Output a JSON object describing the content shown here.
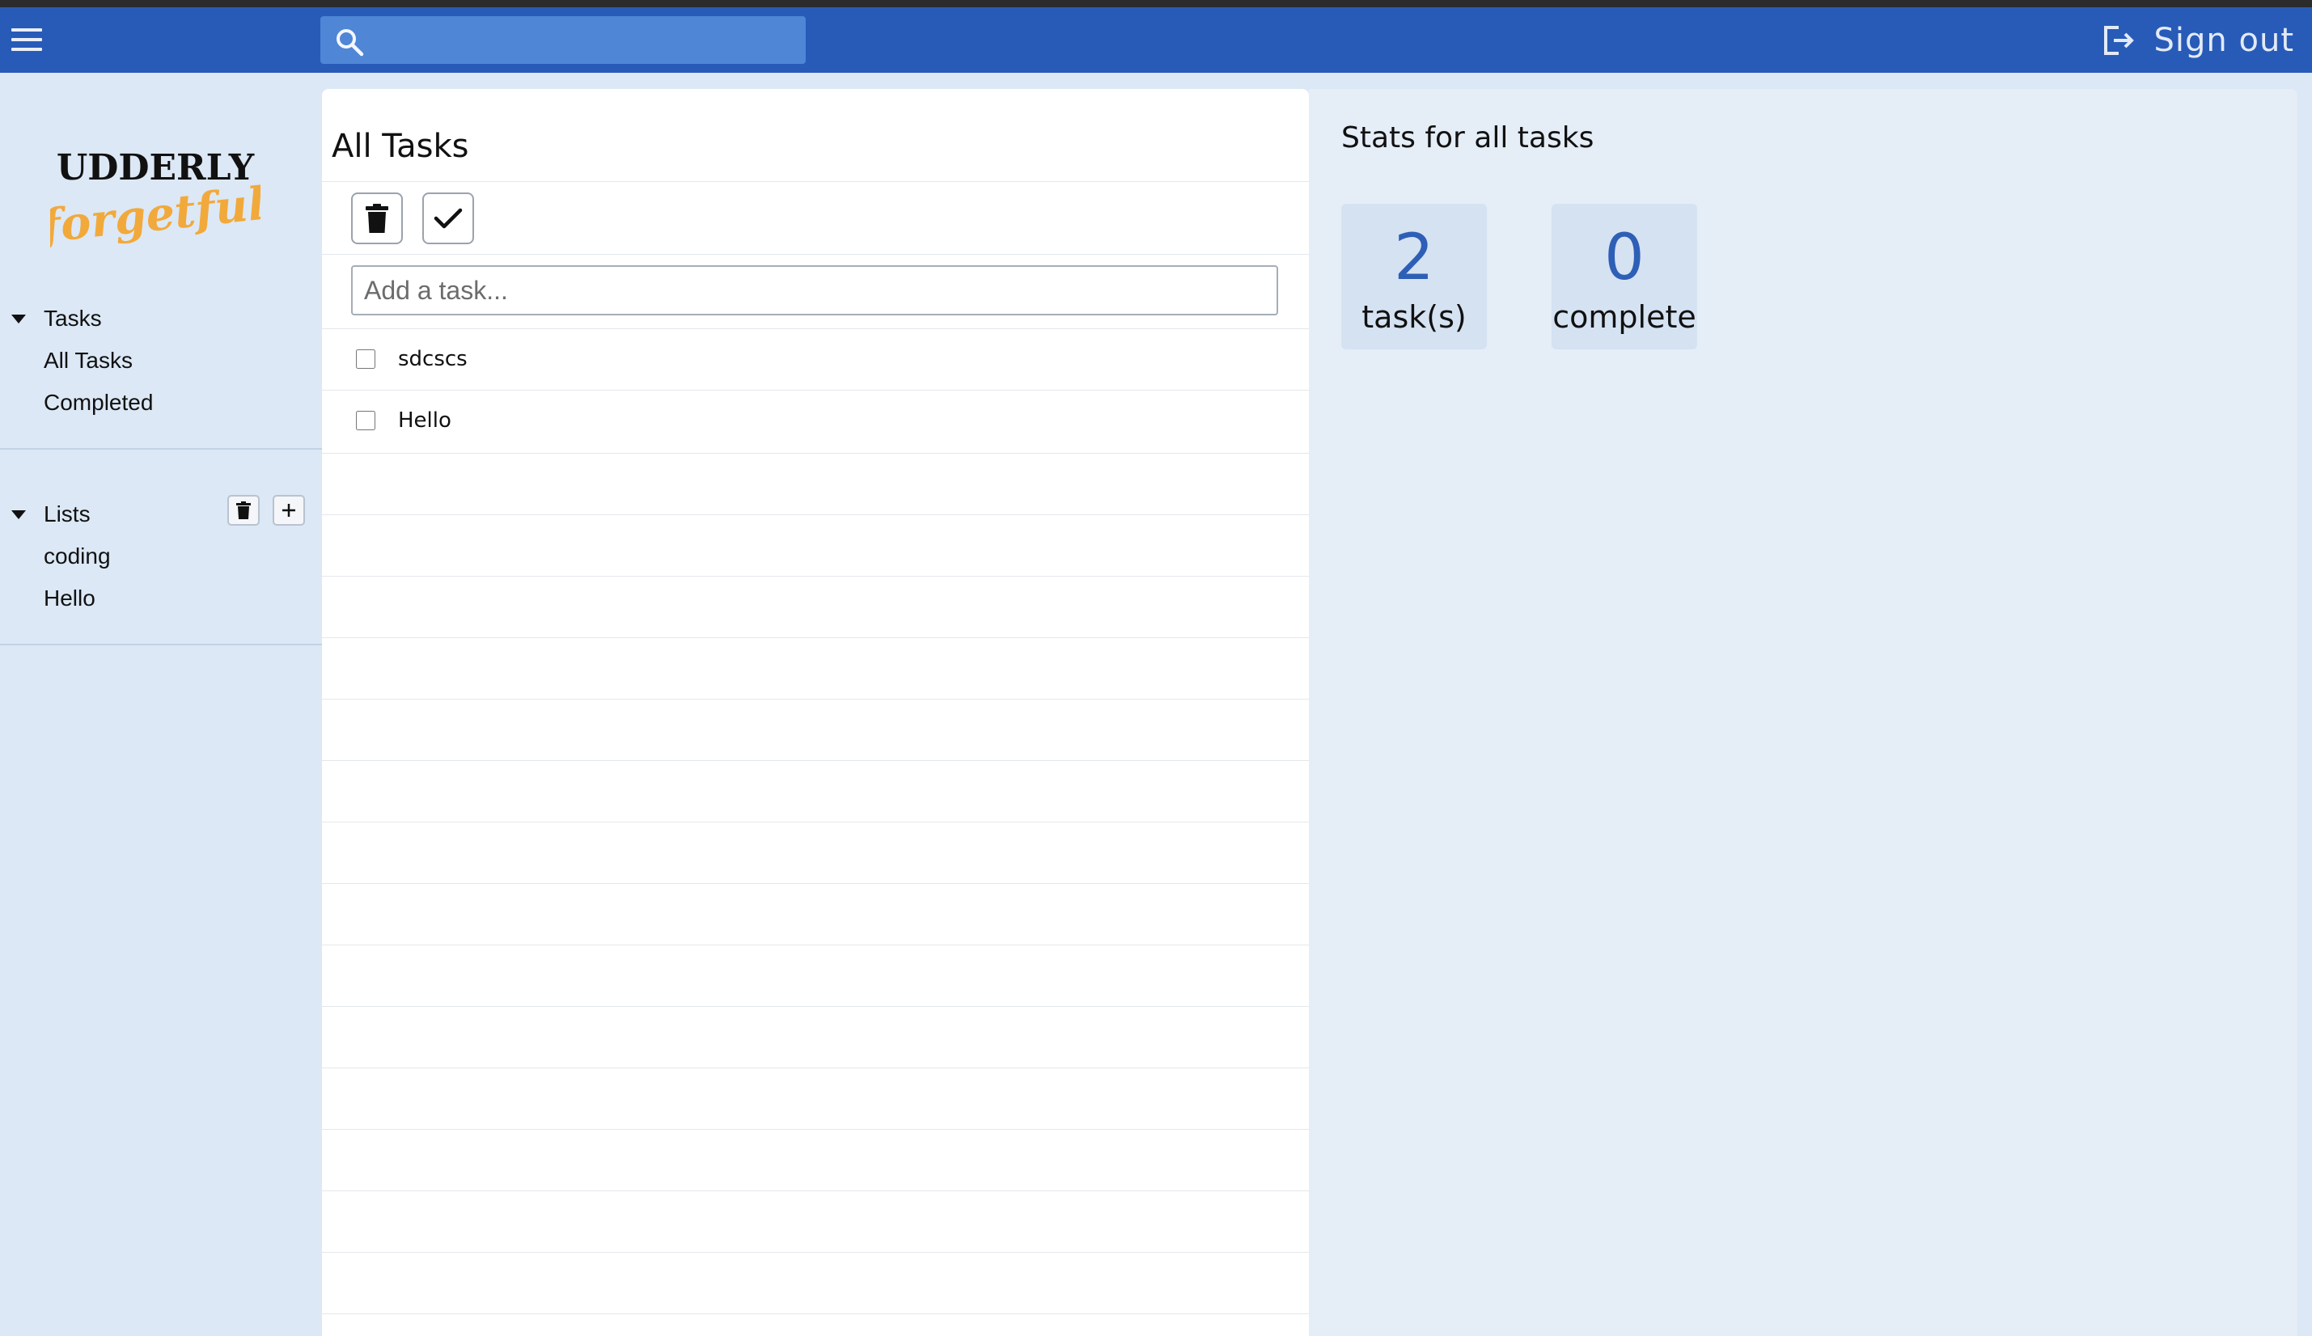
{
  "header": {
    "search_placeholder": "",
    "sign_out_label": "Sign out"
  },
  "logo": {
    "line1": "UDDERLY",
    "line2": "forgetful",
    "line1_color": "#111111",
    "line2_color": "#f2a93b"
  },
  "sidebar": {
    "tasks_section": {
      "label": "Tasks",
      "items": [
        {
          "label": "All Tasks"
        },
        {
          "label": "Completed"
        }
      ]
    },
    "lists_section": {
      "label": "Lists",
      "items": [
        {
          "label": "coding"
        },
        {
          "label": "Hello"
        }
      ]
    }
  },
  "main": {
    "title": "All Tasks",
    "add_task_placeholder": "Add a task...",
    "tasks": [
      {
        "text": "sdcscs",
        "checked": false
      },
      {
        "text": "Hello",
        "checked": false
      }
    ]
  },
  "stats": {
    "title": "Stats for all tasks",
    "cards": [
      {
        "value": "2",
        "label": "task(s)"
      },
      {
        "value": "0",
        "label": "complete"
      }
    ]
  },
  "colors": {
    "topbar": "#285bb8",
    "search_bg": "#4f86d6",
    "sidebar_bg": "#dce8f5",
    "stats_bg": "#e5edf7",
    "stat_value": "#2e5fb6",
    "logo_accent": "#f2a93b"
  },
  "icons": {
    "menu": "hamburger-icon",
    "search": "search-icon",
    "sign_out": "sign-out-icon",
    "delete": "trash-icon",
    "complete": "checkmark-icon",
    "add": "plus-icon",
    "expand": "caret-down-icon"
  }
}
